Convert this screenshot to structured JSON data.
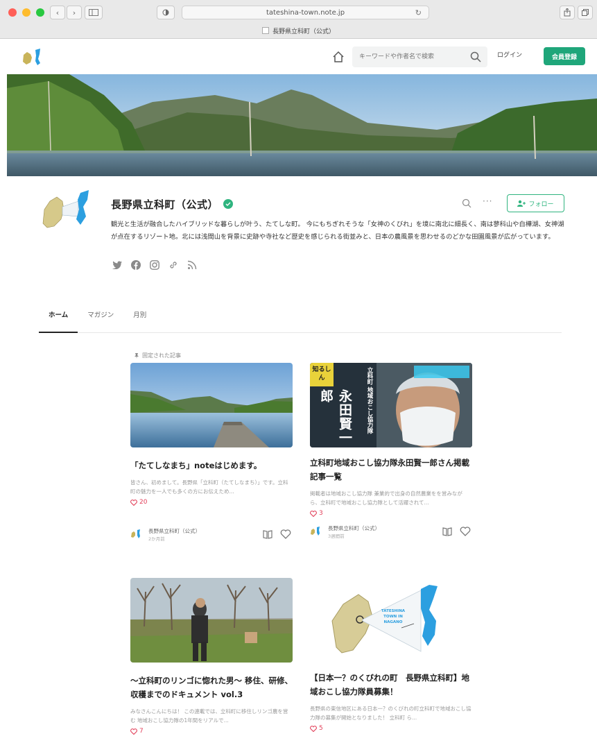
{
  "browser": {
    "url": "tateshina-town.note.jp",
    "tab_title": "長野県立科町（公式）"
  },
  "header": {
    "search_placeholder": "キーワードや作者名で検索",
    "login_label": "ログイン",
    "signup_label": "会員登録",
    "accent_color": "#1fa67a"
  },
  "profile": {
    "name": "長野県立科町（公式）",
    "bio": "観光と生活が融合したハイブリッドな暮らしが叶う、たてしな町。 今にもちぎれそうな「女神のくびれ」を境に南北に細長く、南は蓼科山や白樺湖、女神湖が点在するリゾート地。北には浅間山を背景に史跡や寺社など歴史を感じられる街並みと、日本の農風景を思わせるのどかな田園風景が広がっています。",
    "follow_label": "フォロー",
    "social_icons": [
      "twitter-icon",
      "facebook-icon",
      "instagram-icon",
      "link-icon",
      "rss-icon"
    ]
  },
  "tabs": [
    "ホーム",
    "マガジン",
    "月別"
  ],
  "pinned_label": "固定された記事",
  "cards": [
    {
      "title": "「たてしなまち」noteはじめます。",
      "excerpt": "皆さん、初めまして。長野県「立科町（たてしなまち）」です。立科町の魅力を一人でも多くの方にお伝えため...",
      "likes": "20",
      "author": "長野県立科町（公式）",
      "time": "2か月前"
    },
    {
      "title": "立科町地域おこし協力隊永田賢一郎さん掲載記事一覧",
      "excerpt": "掲載者は地域おこし協力隊 兼業的で出身の自然農業をを営みながら、立科町で地域おこし協力隊として活躍されて...",
      "likes": "3",
      "author": "長野県立科町（公式）",
      "time": "3週間前",
      "thumb_side_text": "立科町 地域おこし協力隊",
      "thumb_name": "永田賢一郎",
      "thumb_badge": "知るしん"
    },
    {
      "title": "〜立科町のリンゴに惚れた男〜 移住、研修、収穫までのドキュメント vol.3",
      "excerpt": "みなさんこんにちは！ この連載では、立科町に移住しリンゴ農を営む 地域おこし協力隊の1年間をリアルで...",
      "likes": "7"
    },
    {
      "title": "【日本一？のくびれの町　長野県立科町】地域おこし協力隊員募集！",
      "excerpt": "長野県の東信地区にある日本一？のくびれの町立科町で地域おこし協力隊の募集が開始となりました！ 立科町 ら...",
      "likes": "5",
      "map_label": "TATESHINA TOWN IN NAGANO"
    }
  ]
}
